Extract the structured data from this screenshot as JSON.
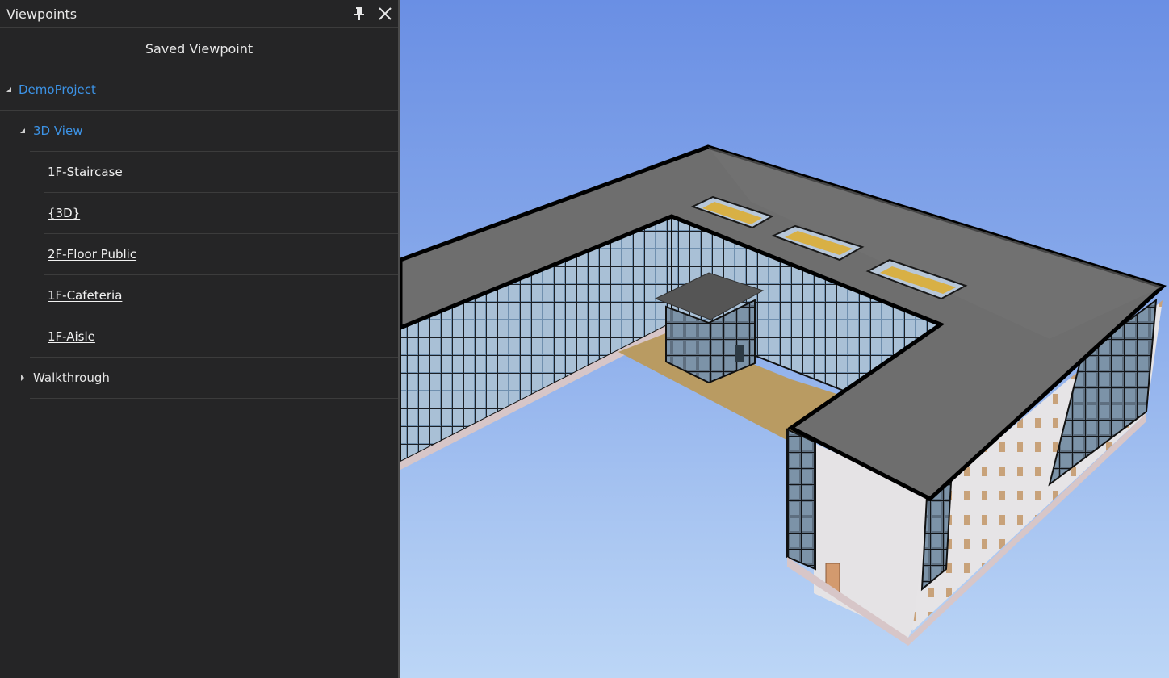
{
  "panel": {
    "title": "Viewpoints",
    "pin_icon": "pin-icon",
    "close_icon": "close-icon",
    "saved_header": "Saved Viewpoint"
  },
  "tree": {
    "project": {
      "label": "DemoProject",
      "expanded": true
    },
    "view3d": {
      "label": "3D View",
      "expanded": true
    },
    "viewpoints": [
      {
        "label": "1F-Staircase"
      },
      {
        "label": "{3D}"
      },
      {
        "label": "2F-Floor Public"
      },
      {
        "label": "1F-Cafeteria"
      },
      {
        "label": "1F-Aisle"
      }
    ],
    "walkthrough": {
      "label": "Walkthrough",
      "expanded": false
    }
  },
  "colors": {
    "panel_bg": "#252526",
    "accent_blue": "#3c93e6",
    "sky_top": "#6a8fe4",
    "sky_bottom": "#bcd6f6",
    "roof": "#6e6e6e",
    "courtyard_floor": "#b99b62"
  },
  "viewport": {
    "content": "3D building model"
  }
}
